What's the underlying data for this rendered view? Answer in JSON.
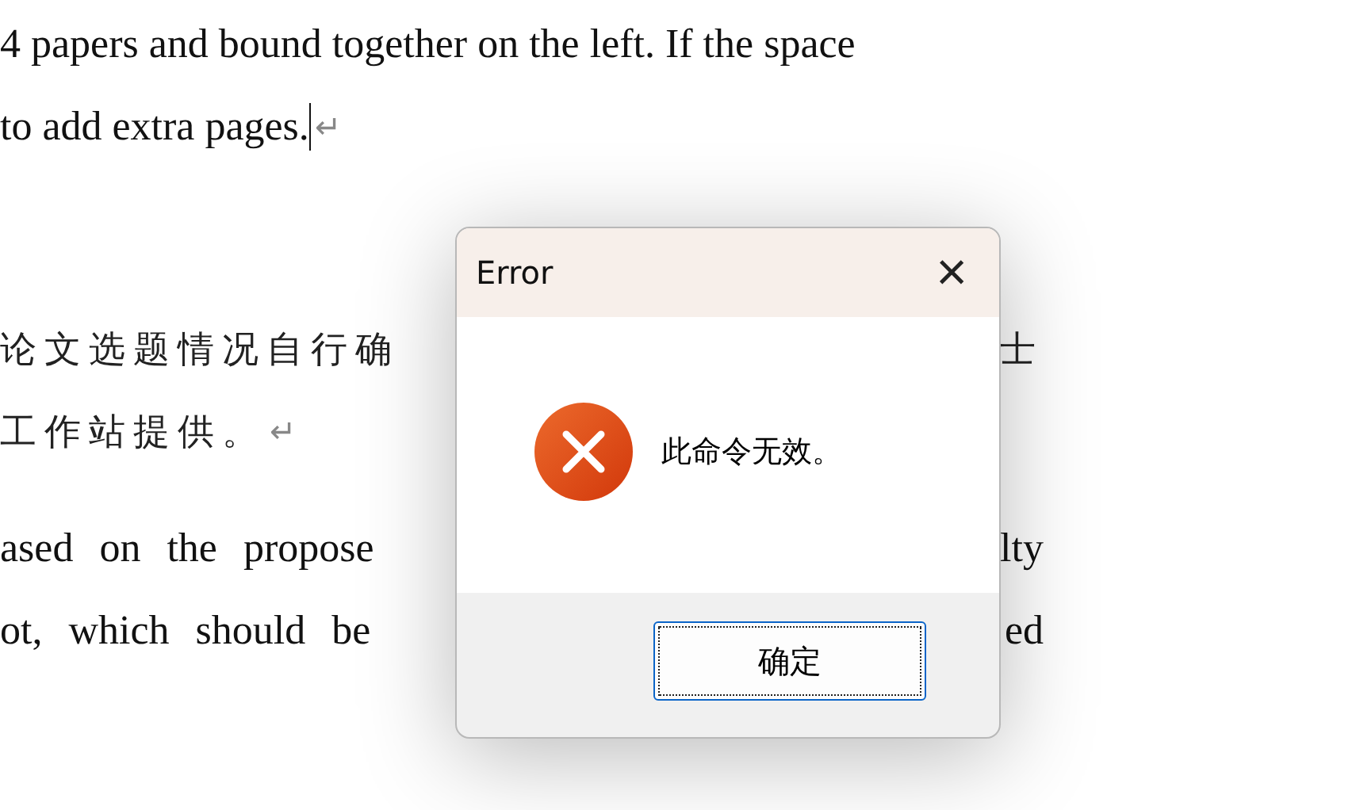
{
  "document": {
    "lines": [
      {
        "left": "4 papers and bound together on the left. If the space"
      },
      {
        "left": "to add extra pages.",
        "cursor": true,
        "mark": "↵"
      },
      {
        "left": "论文选题情况自行确",
        "right": "士"
      },
      {
        "left": "工作站提供。",
        "mark": "↵"
      },
      {
        "left": "ased on the propose",
        "right": "lty"
      },
      {
        "left": "ot, which should be",
        "right": "ed"
      }
    ]
  },
  "dialog": {
    "title": "Error",
    "close": "×",
    "kind": "error",
    "message": "此命令无效。",
    "buttons": [
      {
        "label": "确定",
        "focused": true
      }
    ]
  }
}
